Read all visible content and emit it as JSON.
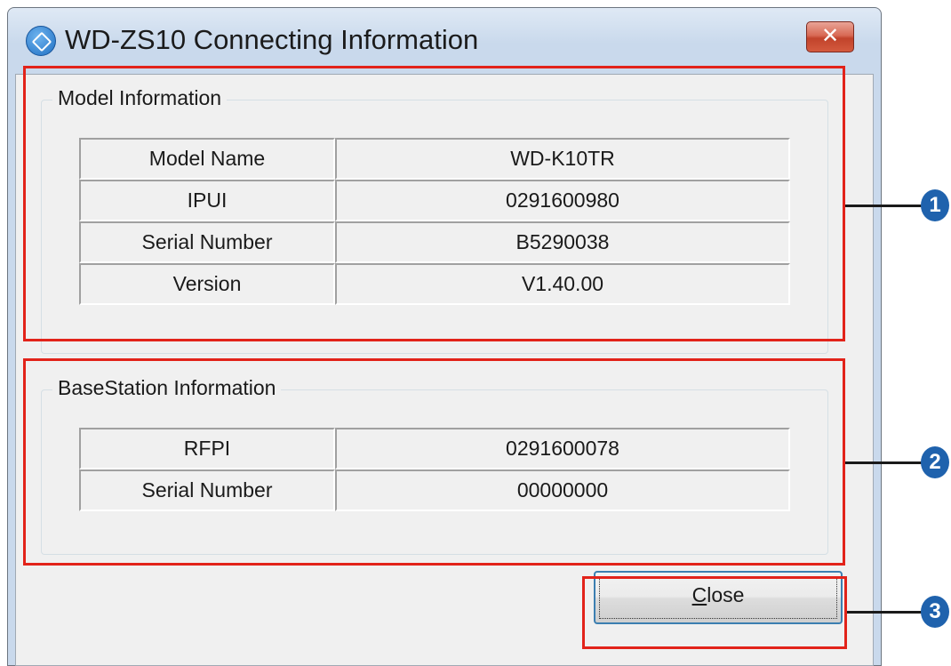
{
  "window": {
    "title": "WD-ZS10 Connecting Information",
    "close_glyph": "✕"
  },
  "model_info": {
    "legend": "Model Information",
    "rows": [
      {
        "label": "Model Name",
        "value": "WD-K10TR"
      },
      {
        "label": "IPUI",
        "value": "0291600980"
      },
      {
        "label": "Serial Number",
        "value": "B5290038"
      },
      {
        "label": "Version",
        "value": "V1.40.00"
      }
    ]
  },
  "base_info": {
    "legend": "BaseStation Information",
    "rows": [
      {
        "label": "RFPI",
        "value": "0291600078"
      },
      {
        "label": "Serial Number",
        "value": "00000000"
      }
    ]
  },
  "buttons": {
    "close_mnemonic": "C",
    "close_rest": "lose"
  },
  "annotations": {
    "badge_1": "1",
    "badge_2": "2",
    "badge_3": "3",
    "highlight_color": "#e2231a",
    "badge_color": "#1f62ad"
  },
  "icons": {
    "app": "app-icon",
    "close": "close-icon"
  }
}
